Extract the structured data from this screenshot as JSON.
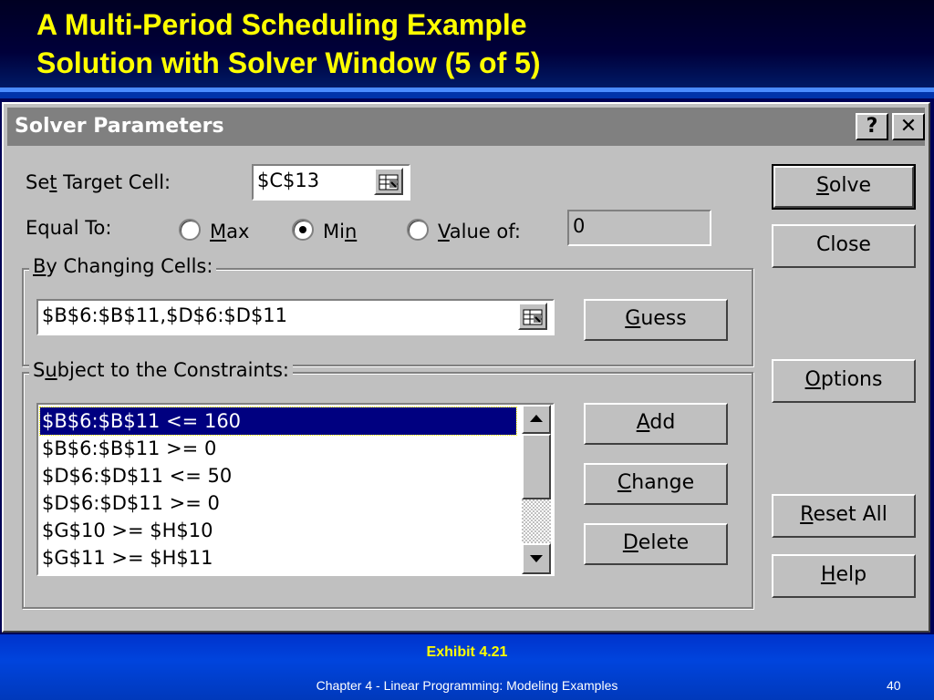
{
  "slide": {
    "title_line1": "A Multi-Period Scheduling Example",
    "title_line2": "Solution with Solver Window (5 of 5)",
    "exhibit": "Exhibit 4.21",
    "footer": "Chapter 4 - Linear Programming:  Modeling Examples",
    "page_number": "40"
  },
  "dialog": {
    "title": "Solver Parameters",
    "help_label": "?",
    "close_label": "✕",
    "target_cell": {
      "label_pre": "Se",
      "label_u": "t",
      "label_post": " Target Cell:",
      "value": "$C$13"
    },
    "equal_to": {
      "label": "Equal To:",
      "options": [
        {
          "pre": "",
          "u": "M",
          "post": "ax",
          "selected": false
        },
        {
          "pre": "Mi",
          "u": "n",
          "post": "",
          "selected": true
        },
        {
          "pre": "",
          "u": "V",
          "post": "alue of:",
          "selected": false
        }
      ],
      "value_of": "0"
    },
    "changing_cells": {
      "label_pre": "",
      "label_u": "B",
      "label_post": "y Changing Cells:",
      "value": "$B$6:$B$11,$D$6:$D$11"
    },
    "constraints": {
      "label_pre": "S",
      "label_u": "u",
      "label_post": "bject to the Constraints:",
      "items": [
        "$B$6:$B$11 <= 160",
        "$B$6:$B$11 >= 0",
        "$D$6:$D$11 <= 50",
        "$D$6:$D$11 >= 0",
        "$G$10 >= $H$10",
        "$G$11 >= $H$11"
      ],
      "selected_index": 0
    },
    "buttons": {
      "solve": {
        "pre": "",
        "u": "S",
        "post": "olve"
      },
      "close": {
        "pre": "Close",
        "u": "",
        "post": ""
      },
      "guess": {
        "pre": "",
        "u": "G",
        "post": "uess"
      },
      "options": {
        "pre": "",
        "u": "O",
        "post": "ptions"
      },
      "add": {
        "pre": "",
        "u": "A",
        "post": "dd"
      },
      "change": {
        "pre": "",
        "u": "C",
        "post": "hange"
      },
      "delete": {
        "pre": "",
        "u": "D",
        "post": "elete"
      },
      "reset_all": {
        "pre": "",
        "u": "R",
        "post": "eset All"
      },
      "help": {
        "pre": "",
        "u": "H",
        "post": "elp"
      }
    }
  }
}
